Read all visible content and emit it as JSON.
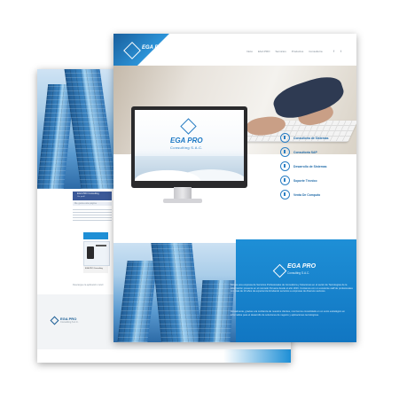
{
  "brand": {
    "name": "EGA PRO",
    "tagline": "Consulting S.A.C.",
    "accent": "#1e8fd6",
    "dark": "#1b5e96"
  },
  "front_page": {
    "nav": [
      "Inicio",
      "EGA PRO",
      "Servicios",
      "Productos",
      "Consultoría"
    ],
    "services": [
      {
        "label": "Consultoría de Sistemas",
        "icon": "gear-icon"
      },
      {
        "label": "Consultoría SAP",
        "icon": "sap-icon"
      },
      {
        "label": "Desarrollo de Sistemas",
        "icon": "code-icon"
      },
      {
        "label": "Soporte Técnico",
        "icon": "wrench-icon"
      },
      {
        "label": "Venta De Computo",
        "icon": "computer-icon"
      }
    ],
    "paragraph1": "Somos una empresa de Servicios Profesionales de Consultoría y Soluciones en el sector de Tecnologías de la Información presente en el mercado Peruano desde el año 2016. Contamos con un excelente staff de profesionales con más de 10 años de experiencia brindando servicios a empresas de diversos sectores.",
    "paragraph2": "Actualmente, gracias a la confianza de nuestros clientes, nos hemos consolidado en un socio estratégico en informática para el desarrollo de soluciones de negocio y aplicaciones tecnológicas."
  },
  "back_page": {
    "menu_title": "EGA PRO Consulting",
    "menu_link": "Ver perfil",
    "post_header": "Me gusta esta página",
    "caption": "Descargue la aplicación móvil",
    "footer_brand": "EGA PRO",
    "footer_sub": "Consulting S.A.C."
  }
}
